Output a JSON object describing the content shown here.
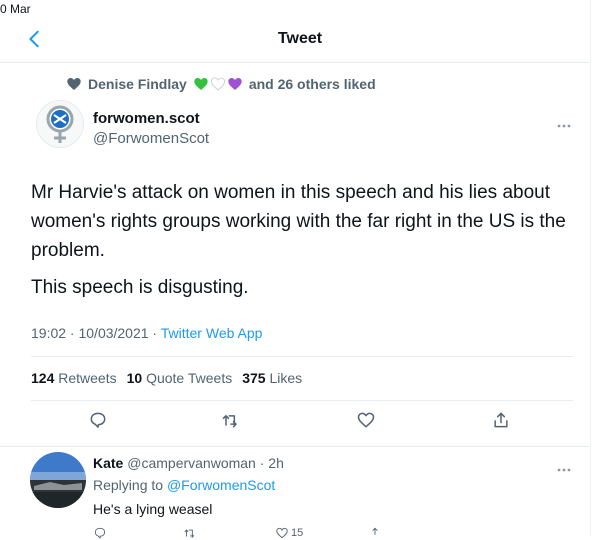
{
  "status_bar": {
    "date": "0 Mar"
  },
  "nav": {
    "title": "Tweet"
  },
  "social_context": {
    "name": "Denise Findlay",
    "suffix": "and 26 others liked"
  },
  "tweet": {
    "author_name": "forwomen.scot",
    "author_handle": "@ForwomenScot",
    "paragraphs": [
      "Mr Harvie's attack on women in this speech and his lies about women's rights groups working with the far right in the US is the problem.",
      "This speech is disgusting."
    ],
    "timestamp": "19:02 · 10/03/2021 · ",
    "app": "Twitter Web App",
    "retweets_count": "124",
    "retweets_label": "Retweets",
    "quotes_count": "10",
    "quotes_label": "Quote Tweets",
    "likes_count": "375",
    "likes_label": "Likes"
  },
  "reply": {
    "author_name": "Kate",
    "author_handle": "@campervanwoman",
    "time": "· 2h",
    "replying_prefix": "Replying to",
    "replying_to": "@ForwomenScot",
    "text": "He's a lying weasel",
    "likes_count": "15"
  },
  "colors": {
    "accent": "#1d9bf0",
    "secondary_text": "#536471",
    "divider": "#e6ecf0"
  }
}
